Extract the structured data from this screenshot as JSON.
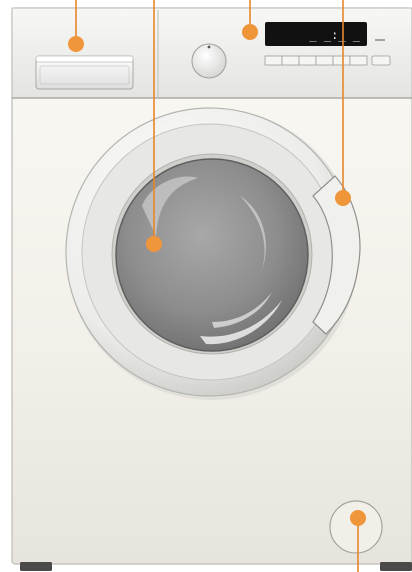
{
  "display": {
    "readout": "_ _:_ _"
  },
  "colors": {
    "marker": "#f0963a",
    "leader": "#e8862c",
    "body_light": "#f4f2ec",
    "body_shadow": "#d9d7cf",
    "display_bg": "#111111",
    "display_text": "#e6e6e6"
  },
  "parts": [
    {
      "name": "detergent-drawer-marker"
    },
    {
      "name": "door-glass-marker"
    },
    {
      "name": "control-panel-marker"
    },
    {
      "name": "door-handle-marker"
    },
    {
      "name": "filter-hatch-marker"
    }
  ],
  "buttons": {
    "count": 6
  }
}
